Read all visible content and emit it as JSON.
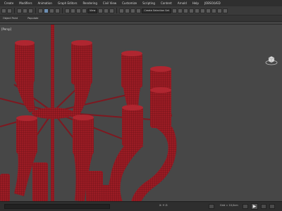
{
  "menubar": {
    "items": [
      "Create",
      "Modifiers",
      "Animation",
      "Graph Editors",
      "Rendering",
      "Civil View",
      "Customize",
      "Scripting",
      "Content",
      "Arnold",
      "Help",
      "JOBSOLVED"
    ]
  },
  "toolbar": {
    "view_dropdown": "View",
    "selection_set_placeholder": "Create Selection Set"
  },
  "ribbon": {
    "tabs": [
      "Object Paint",
      "Populate"
    ]
  },
  "viewport": {
    "label": "[Persp]",
    "model_color": "#9b1c24",
    "background_color": "#474747"
  },
  "statusbar": {
    "coords": "X:   Y:   Z:",
    "grid": "Grid = 10,0cm",
    "add_time_tag": "Add Time Tag"
  }
}
